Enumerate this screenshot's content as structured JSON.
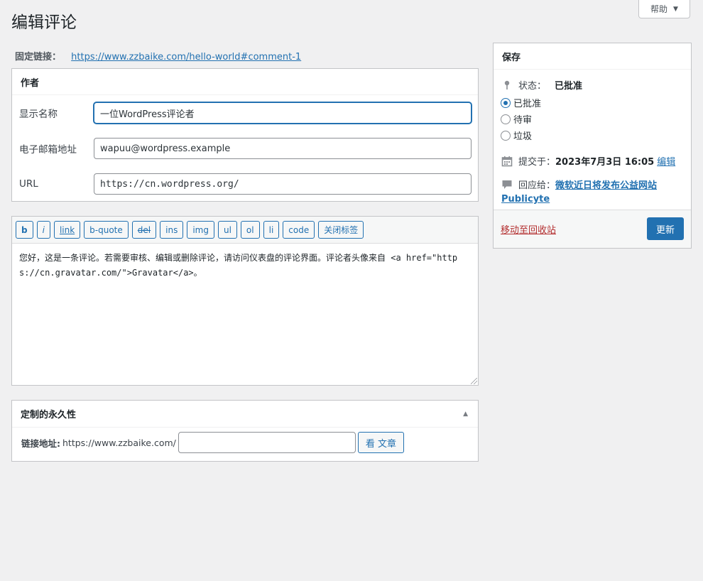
{
  "help": {
    "label": "帮助",
    "arrow": "▼"
  },
  "page": {
    "title": "编辑评论"
  },
  "permalink": {
    "label": "固定链接：",
    "url": "https://www.zzbaike.com/hello-world#comment-1"
  },
  "author": {
    "heading": "作者",
    "name_label": "显示名称",
    "name_value": "一位WordPress评论者",
    "email_label": "电子邮箱地址",
    "email_value": "wapuu@wordpress.example",
    "url_label": "URL",
    "url_value": "https://cn.wordpress.org/"
  },
  "editor": {
    "buttons": [
      "b",
      "i",
      "link",
      "b-quote",
      "del",
      "ins",
      "img",
      "ul",
      "ol",
      "li",
      "code",
      "关闭标签"
    ],
    "content": "您好，这是一条评论。若需要审核、编辑或删除评论，请访问仪表盘的评论界面。评论者头像来自 <a href=\"https://cn.gravatar.com/\">Gravatar</a>。"
  },
  "slug": {
    "heading": "定制的永久性",
    "toggle": "▲",
    "label": "链接地址:",
    "prefix": "https://www.zzbaike.com/",
    "value": "",
    "view_button": "看 文章"
  },
  "save": {
    "heading": "保存",
    "status_label": "状态：",
    "status_value": "已批准",
    "options": [
      {
        "label": "已批准",
        "checked": true
      },
      {
        "label": "待审",
        "checked": false
      },
      {
        "label": "垃圾",
        "checked": false
      }
    ],
    "submitted_label": "提交于：",
    "submitted_value": "2023年7月3日 16:05",
    "edit_link": "编辑",
    "reply_label": "回应给：",
    "reply_link_line1": "微软近日将发布公益网站",
    "reply_link_line2": "Publicyte",
    "trash_link": "移动至回收站",
    "update_button": "更新"
  },
  "colors": {
    "accent": "#2271b1",
    "danger": "#b32d2e",
    "background": "#f0f0f1"
  }
}
